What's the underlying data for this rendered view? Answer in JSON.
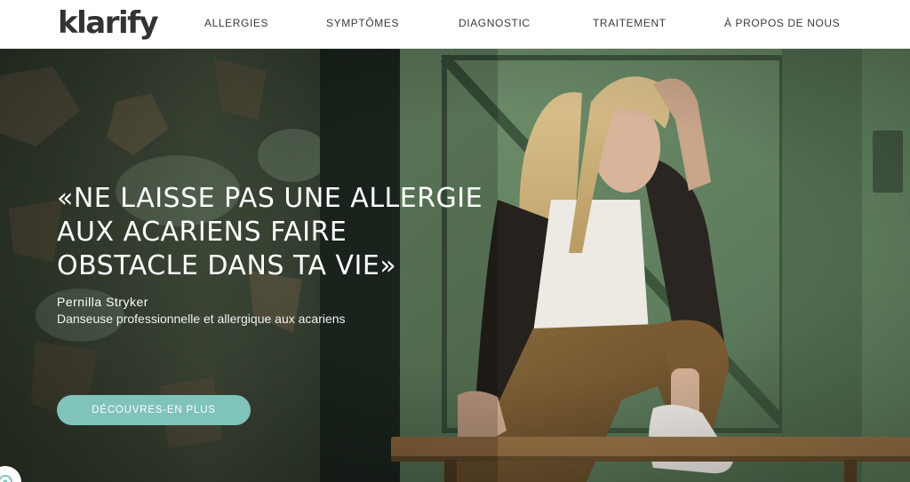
{
  "brand": {
    "name": "klarify",
    "accent": "#7fc3bb"
  },
  "nav": {
    "items": [
      {
        "label": "ALLERGIES"
      },
      {
        "label": "SYMPTÔMES"
      },
      {
        "label": "DIAGNOSTIC"
      },
      {
        "label": "TRAITEMENT"
      },
      {
        "label": "À PROPOS DE NOUS"
      }
    ]
  },
  "hero": {
    "quote_lines": [
      "«NE LAISSE PAS UNE ALLERGIE",
      "AUX ACARIENS FAIRE",
      "OBSTACLE DANS TA VIE»"
    ],
    "author_name": "Pernilla Stryker",
    "author_role": "Danseuse professionnelle et allergique aux acariens",
    "cta_label": "DÉCOUVRES-EN PLUS"
  },
  "widgets": {
    "chat_icon": "chat-bubble-icon"
  }
}
